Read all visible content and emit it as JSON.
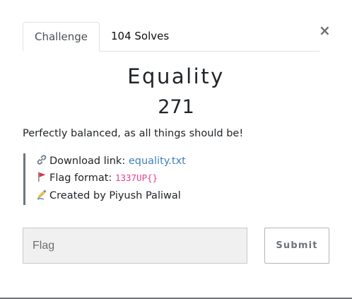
{
  "modal": {
    "close_label": "×"
  },
  "tabs": [
    {
      "label": "Challenge",
      "active": true
    },
    {
      "label": "104 Solves",
      "active": false
    }
  ],
  "challenge": {
    "name": "Equality",
    "value": "271",
    "description": "Perfectly balanced, as all things should be!",
    "details": {
      "download": {
        "icon": "link-icon",
        "label": "Download link: ",
        "link_text": "equality.txt"
      },
      "flag_format": {
        "icon": "red-flag-icon",
        "label": "Flag format: ",
        "code": "1337UP{}"
      },
      "author": {
        "icon": "writing-hand-icon",
        "text": "Created by Piyush Paliwal"
      }
    }
  },
  "form": {
    "flag_placeholder": "Flag",
    "submit_label": "Submit"
  },
  "colors": {
    "link": "#3f7fbf",
    "code": "#e83e8c",
    "quote_border": "#6c757d",
    "flag_icon": "#e0334a"
  }
}
